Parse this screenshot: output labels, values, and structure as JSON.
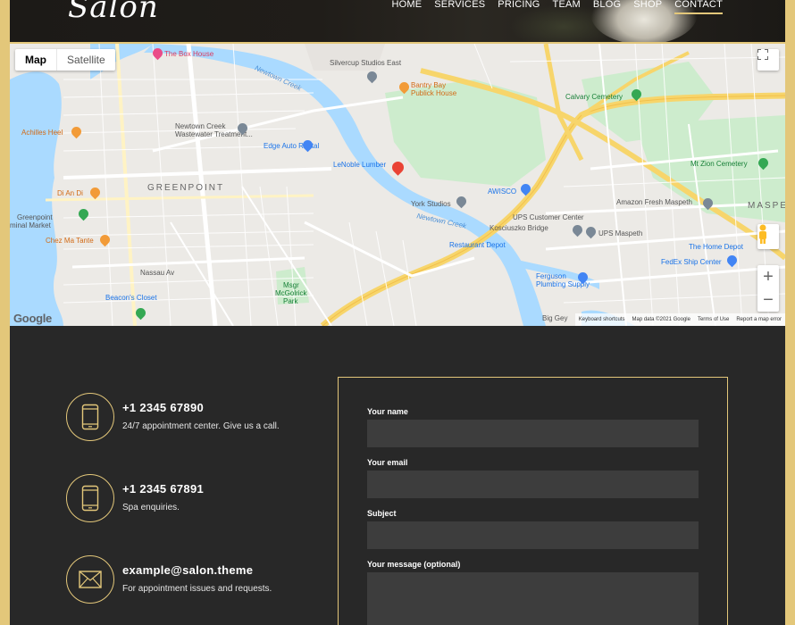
{
  "header": {
    "logo": "Salon",
    "nav": [
      "HOME",
      "SERVICES",
      "PRICING",
      "TEAM",
      "BLOG",
      "SHOP",
      "CONTACT"
    ],
    "active_nav": "CONTACT"
  },
  "map": {
    "type_buttons": {
      "map": "Map",
      "satellite": "Satellite"
    },
    "zoom_in": "+",
    "zoom_out": "−",
    "google": "Google",
    "attribution": [
      "Keyboard shortcuts",
      "Map data ©2021 Google",
      "Terms of Use",
      "Report a map error"
    ],
    "labels": {
      "box_house": "The Box House",
      "silvercup": "Silvercup Studios East",
      "newtown_creek_top": "Newtown Creek",
      "bantry": "Bantry Bay",
      "bantry2": "Publick House",
      "calvary": "Calvary Cemetery",
      "achilles": "Achilles Heel",
      "nc_wastewater": "Newtown Creek",
      "nc_wastewater2": "Wastewater Treatment...",
      "edge_auto": "Edge Auto Rental",
      "lenoble": "LeNoble Lumber",
      "mt_zion": "Mt Zion Cemetery",
      "greenpoint": "GREENPOINT",
      "di_an_di": "Di An Di",
      "york": "York Studios",
      "awisco": "AWISCO",
      "amazon": "Amazon Fresh Maspeth",
      "maspeth": "MASPE",
      "gp_terminal": "Greenpoint",
      "gp_terminal2": "minal Market",
      "newtown_creek_bottom": "Newtown Creek",
      "ups_customer": "UPS Customer Center",
      "kosciuszko": "Kosciuszko Bridge",
      "ups_maspeth": "UPS Maspeth",
      "chez_ma": "Chez Ma Tante",
      "restaurant_depot": "Restaurant Depot",
      "home_depot": "The Home Depot",
      "fedex": "FedEx Ship Center",
      "nassau": "Nassau Av",
      "msgr": "Msgr",
      "msgr2": "McGolrick",
      "msgr3": "Park",
      "ferguson": "Ferguson",
      "ferguson2": "Plumbing Supply",
      "beacons": "Beacon's Closet",
      "big_gey": "Big Gey"
    }
  },
  "contact": {
    "items": [
      {
        "icon": "phone-icon",
        "title": "+1 2345 67890",
        "sub": "24/7 appointment center. Give us a call."
      },
      {
        "icon": "phone-icon",
        "title": "+1 2345 67891",
        "sub": "Spa enquiries."
      },
      {
        "icon": "mail-icon",
        "title": "example@salon.theme",
        "sub": "For appointment issues and requests."
      }
    ],
    "form": {
      "name_label": "Your name",
      "email_label": "Your email",
      "subject_label": "Subject",
      "message_label": "Your message (optional)"
    }
  },
  "colors": {
    "accent": "#e3c77a",
    "dark": "#282828",
    "field": "#3d3d3d"
  }
}
